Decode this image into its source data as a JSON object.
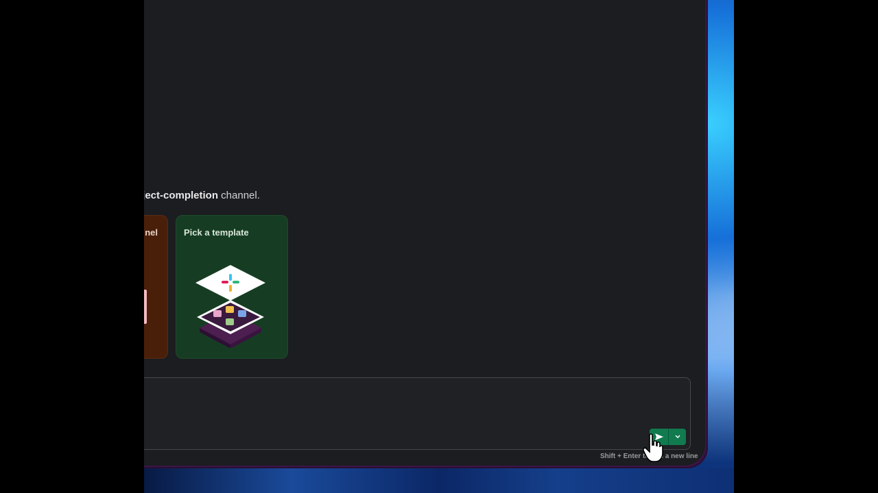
{
  "intro": {
    "channel_name": "oject-completion",
    "suffix": " channel."
  },
  "cards": [
    {
      "title": "nel",
      "color": "#4a1f0a"
    },
    {
      "title": "Pick a template",
      "color": "#163d23"
    }
  ],
  "composer": {
    "value": "",
    "send_icon": "paper-plane-icon",
    "options_icon": "chevron-down-icon",
    "hint_text": "Shift + Enter to add a new line"
  },
  "colors": {
    "window_bg": "#1b1d21",
    "send_button": "#117a4f",
    "window_border": "#3c1545"
  }
}
